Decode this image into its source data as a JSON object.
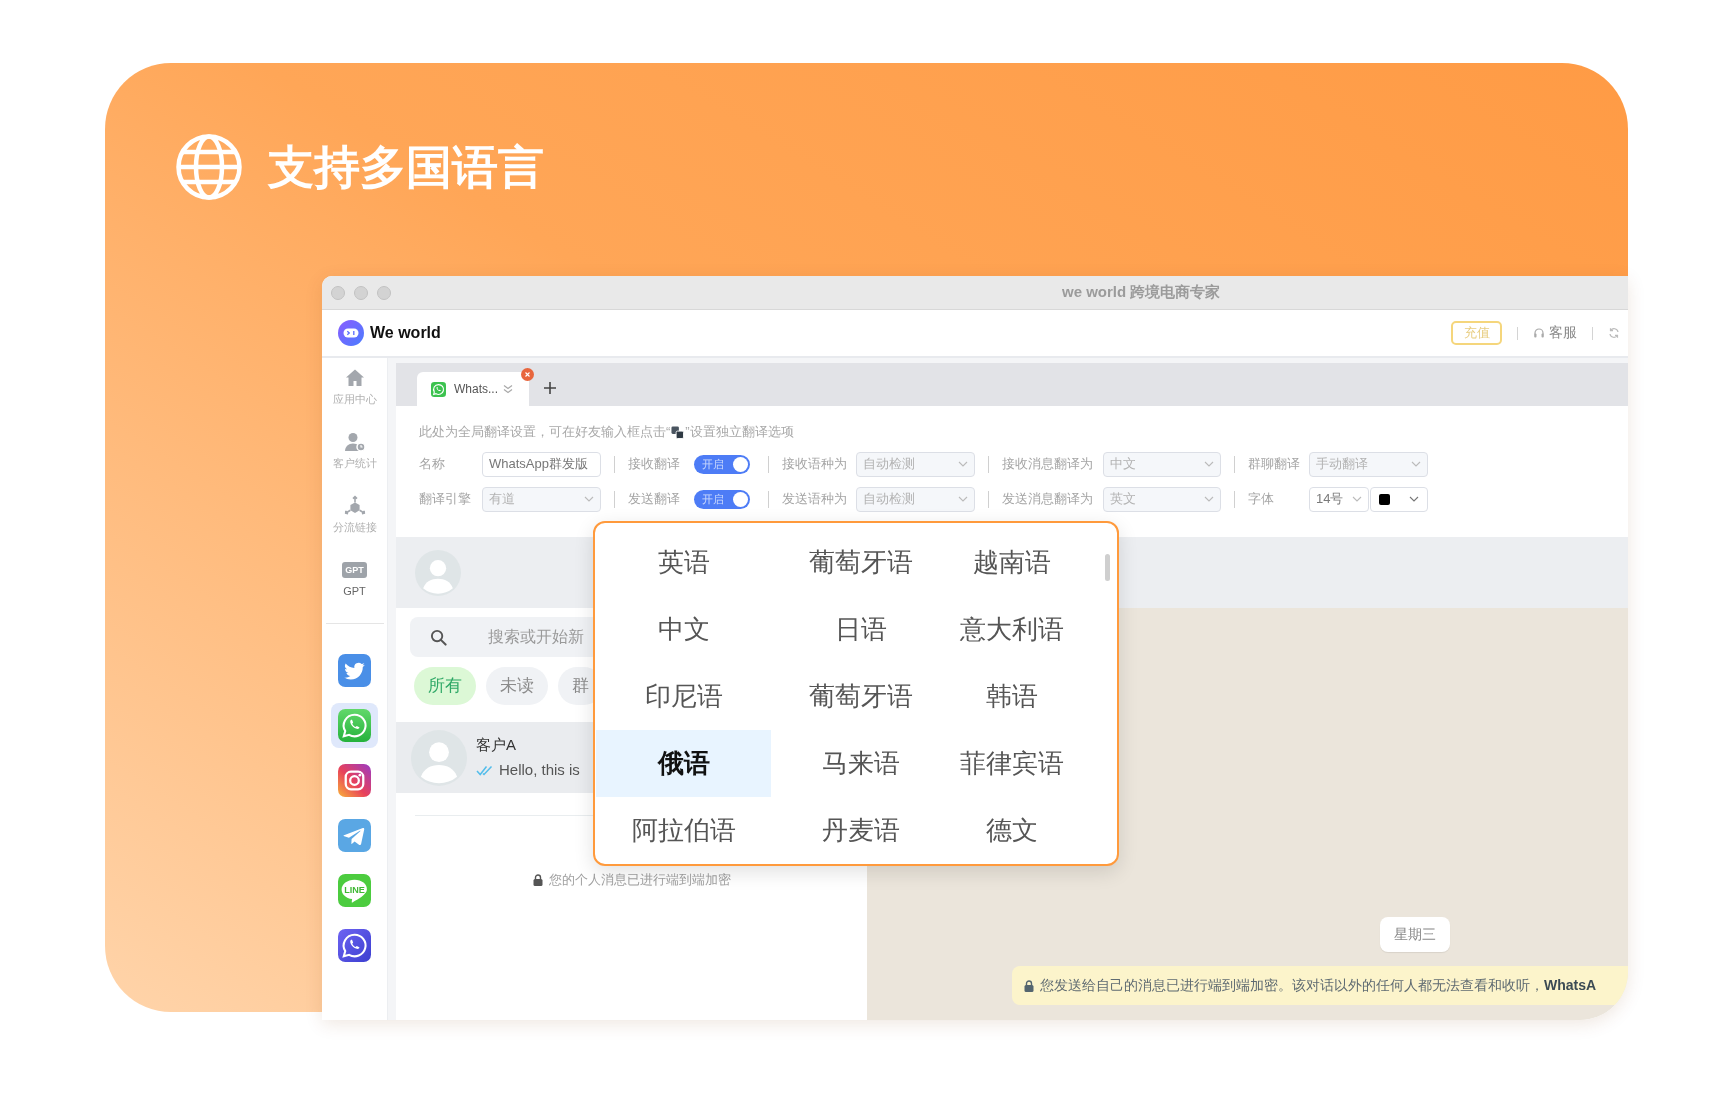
{
  "promo": {
    "title": "支持多国语言"
  },
  "window": {
    "title": "we world 跨境电商专家"
  },
  "header": {
    "app_name": "We world",
    "recharge_button": "充值",
    "support_link": "客服"
  },
  "sidebar": {
    "items": [
      {
        "kind": "home",
        "label": "应用中心"
      },
      {
        "kind": "customers",
        "label": "客户统计"
      },
      {
        "kind": "links",
        "label": "分流链接"
      },
      {
        "kind": "gpt",
        "label": "GPT",
        "badge": "GPT"
      }
    ],
    "apps": [
      {
        "kind": "twitter",
        "selected": false
      },
      {
        "kind": "whatsapp",
        "selected": true
      },
      {
        "kind": "instagram",
        "selected": false
      },
      {
        "kind": "telegram",
        "selected": false
      },
      {
        "kind": "line",
        "selected": false,
        "badge": "LINE"
      },
      {
        "kind": "whatsapp_business",
        "selected": false
      }
    ]
  },
  "tabs": [
    {
      "kind": "whatsapp",
      "label": "Whats...",
      "selected": true
    }
  ],
  "translation_settings": {
    "hint_before": "此处为全局翻译设置，可在好友输入框点击“",
    "hint_after": "”设置独立翻译选项",
    "rows": [
      [
        {
          "label": "名称",
          "kind": "input",
          "value": "WhatsApp群发版"
        },
        {
          "label": "接收翻译",
          "kind": "toggle",
          "on": true,
          "text": "开启"
        },
        {
          "label": "接收语种为",
          "kind": "select",
          "value": "自动检测",
          "disabled": true
        },
        {
          "label": "接收消息翻译为",
          "kind": "select",
          "value": "中文",
          "disabled": true
        },
        {
          "label": "群聊翻译",
          "kind": "select",
          "value": "手动翻译",
          "disabled": true
        }
      ],
      [
        {
          "label": "翻译引擎",
          "kind": "select",
          "value": "有道",
          "disabled": true
        },
        {
          "label": "发送翻译",
          "kind": "toggle",
          "on": true,
          "text": "开启"
        },
        {
          "label": "发送语种为",
          "kind": "select",
          "value": "自动检测",
          "disabled": true
        },
        {
          "label": "发送消息翻译为",
          "kind": "select",
          "value": "英文",
          "disabled": true
        },
        {
          "label": "字体",
          "kind": "font",
          "value": "14号",
          "color": "#000000"
        }
      ]
    ]
  },
  "chat_list": {
    "search": {
      "placeholder": "搜索或开始新"
    },
    "filters": [
      {
        "label": "所有",
        "selected": true
      },
      {
        "label": "未读",
        "selected": false
      },
      {
        "label": "群",
        "selected": false
      }
    ],
    "chats": [
      {
        "name": "客户A",
        "preview": "Hello, this is",
        "read": true,
        "selected": true
      }
    ],
    "encryption_note": "您的个人消息已进行端到端加密"
  },
  "conversation": {
    "day_badge": "星期三",
    "notice": "您发送给自己的消息已进行端到端加密。该对话以外的任何人都无法查看和收听，**WhatsA**"
  },
  "language_menu": {
    "items": [
      {
        "label": "英语",
        "selected": false
      },
      {
        "label": "葡萄牙语",
        "selected": false
      },
      {
        "label": "越南语",
        "selected": false
      },
      {
        "label": "中文",
        "selected": false
      },
      {
        "label": "日语",
        "selected": false
      },
      {
        "label": "意大利语",
        "selected": false
      },
      {
        "label": "印尼语",
        "selected": false
      },
      {
        "label": "葡萄牙语",
        "selected": false
      },
      {
        "label": "韩语",
        "selected": false
      },
      {
        "label": "俄语",
        "selected": true
      },
      {
        "label": "马来语",
        "selected": false
      },
      {
        "label": "菲律宾语",
        "selected": false
      },
      {
        "label": "阿拉伯语",
        "selected": false
      },
      {
        "label": "丹麦语",
        "selected": false
      },
      {
        "label": "德文",
        "selected": false
      }
    ]
  }
}
